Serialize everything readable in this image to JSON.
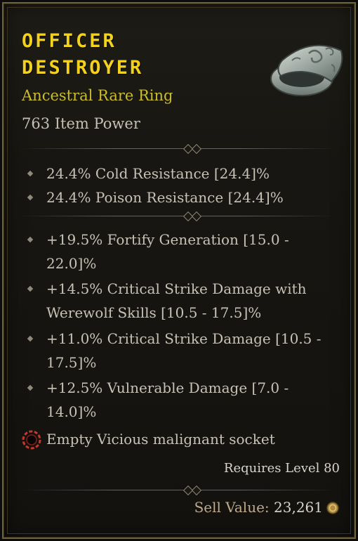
{
  "item": {
    "name_line1": "OFFICER",
    "name_line2": "DESTROYER",
    "type": "Ancestral Rare Ring",
    "power": "763 Item Power"
  },
  "implicits": [
    "24.4% Cold Resistance [24.4]%",
    "24.4% Poison Resistance [24.4]%"
  ],
  "affixes": [
    {
      "line1": "+19.5% Fortify Generation [15.0 -",
      "line2": "22.0]%"
    },
    {
      "line1": "+14.5% Critical Strike Damage with",
      "line2": "Werewolf Skills [10.5 - 17.5]%"
    },
    {
      "line1": "+11.0% Critical Strike Damage [10.5 -",
      "line2": "17.5]%"
    },
    {
      "line1": "+12.5% Vulnerable Damage [7.0 -",
      "line2": "14.0]%"
    }
  ],
  "socket": "Empty Vicious malignant socket",
  "requires": "Requires Level 80",
  "sell": {
    "label": "Sell Value:",
    "value": "23,261"
  },
  "colors": {
    "title": "#f2d21c",
    "rarity": "#c9bd2a",
    "text": "#c8c2b6",
    "border": "#6e643c",
    "socket": "#c0392b"
  },
  "icons": {
    "item": "ring-icon",
    "bullet": "diamond-bullet-icon",
    "socket": "malignant-socket-icon",
    "currency": "gold-coin-icon"
  }
}
